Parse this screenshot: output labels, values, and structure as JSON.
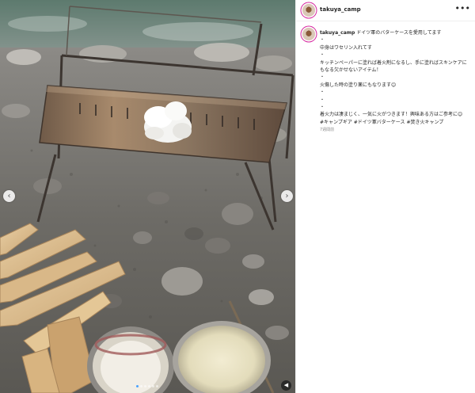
{
  "post": {
    "username": "takuya_camp",
    "caption_lines": [
      "ドイツ軍のバターケースを愛用してます",
      "・",
      "中身はワセリン入れてす",
      "・",
      "キッチンペーパーに塗れば着火剤になるし、手に塗ればスキンケアにもなる欠かせないアイテム！",
      "・",
      "火傷した時の塗り薬にもなります😊",
      "・",
      "・",
      "・",
      "着火力は凄まじく、一気に火がつきます！興味ある方はご参考に😊"
    ],
    "hashtags": [
      "#キャンプギア",
      "#ドイツ軍バターケース",
      "#焚き火キャンプ"
    ],
    "time_ago": "7週間前"
  },
  "carousel": {
    "total_slides": 6,
    "active_index": 0
  },
  "icons": {
    "prev": "chevron-left-icon",
    "next": "chevron-right-icon",
    "more": "more-horizontal-icon",
    "mute": "speaker-muted-icon"
  },
  "colors": {
    "hashtag": "#00376b",
    "story_ring": "#d6249f",
    "active_dot": "#4aa3ff"
  }
}
